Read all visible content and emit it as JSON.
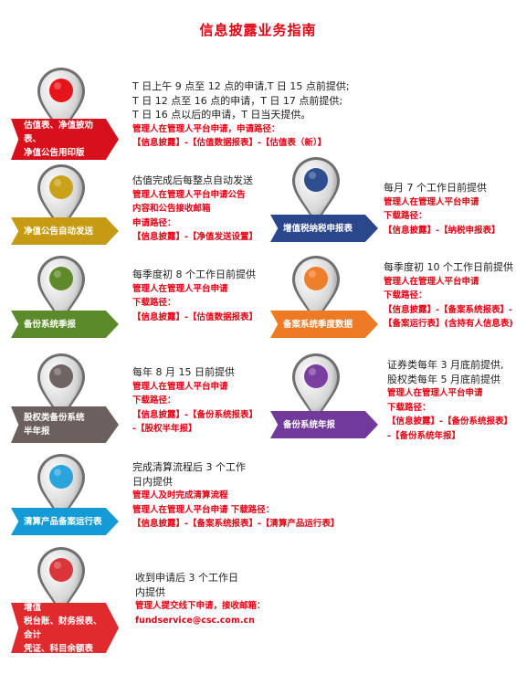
{
  "title": "信息披露业务指南",
  "left": [
    {
      "pin_color": "#e8141b",
      "tag_color": "#d7101b",
      "tag_lines": [
        "估值表、净值披劝表、",
        "净值公告用印版"
      ],
      "text_lines": [
        {
          "t": "T 日上午 9 点至 12 点的申请,T 日 15 点前提供;",
          "c": "k"
        },
        {
          "t": "T 日 12 点至 16 点的申请，T 日 17 点前提供;",
          "c": "k"
        },
        {
          "t": "T 日 16 点以后的申请，T 日当天提供。",
          "c": "k"
        },
        {
          "t": "管理人在管理人平台申请，申请路径：",
          "c": "r"
        },
        {
          "t": "【信息披露】-【估值数据报表】-【估值表（新）】",
          "c": "r"
        }
      ]
    },
    {
      "pin_color": "#c9a21a",
      "tag_color": "#c69a13",
      "tag_lines": [
        "净值公告自动发送"
      ],
      "text_lines": [
        {
          "t": "估值完成后每整点自动发送",
          "c": "k"
        },
        {
          "t": "管理人在管理人平台申请公告",
          "c": "r"
        },
        {
          "t": "内容和公告接收邮箱",
          "c": "r"
        },
        {
          "t": "申请路径：",
          "c": "r"
        },
        {
          "t": "【信息披露】-【净值发送设置】",
          "c": "r"
        }
      ]
    },
    {
      "pin_color": "#5f8a2c",
      "tag_color": "#5b8a2a",
      "tag_lines": [
        "备份系统季报"
      ],
      "text_lines": [
        {
          "t": "每季度初 8 个工作日前提供",
          "c": "k"
        },
        {
          "t": "管理人在管理人平台申请",
          "c": "r"
        },
        {
          "t": "下载路径：",
          "c": "r"
        },
        {
          "t": "【信息披露】-【估值数据报表】",
          "c": "r"
        }
      ]
    },
    {
      "pin_color": "#6f6462",
      "tag_color": "#6b605d",
      "tag_lines": [
        "股权类备份系统",
        "半年报"
      ],
      "text_lines": [
        {
          "t": "每年 8 月 15 日前提供",
          "c": "k"
        },
        {
          "t": "管理人在管理人平台申请",
          "c": "r"
        },
        {
          "t": "下载路径：",
          "c": "r"
        },
        {
          "t": "【信息披露】-【备份系统报表】",
          "c": "r"
        },
        {
          "t": "-【股权半年报】",
          "c": "r"
        }
      ]
    },
    {
      "pin_color": "#2ba4dc",
      "tag_color": "#139ad7",
      "tag_lines": [
        "清算产品备案运行表"
      ],
      "text_lines": [
        {
          "t": "完成清算流程后 3 个工作",
          "c": "k"
        },
        {
          "t": "日内提供",
          "c": "k"
        },
        {
          "t": "管理人及时完成清算流程",
          "c": "r"
        },
        {
          "t": "管理人在管理人平台申请  下载路径：",
          "c": "r"
        },
        {
          "t": "【信息披露】-【备案系统报表】-【清算产品运行表】",
          "c": "r"
        }
      ]
    },
    {
      "pin_color": "#d9353a",
      "tag_color": "#e02a2e",
      "tag_lines": [
        "其他估值材料（例如增值",
        "税台账、财务报表、会计",
        "凭证、科目余额表等）"
      ],
      "text_lines": [
        {
          "t": "收到申请后 3 个工作日",
          "c": "k"
        },
        {
          "t": "内提供",
          "c": "k"
        },
        {
          "t": "管理人提交线下申请，接收邮箱：",
          "c": "r"
        },
        {
          "t": "fundservice@csc.com.cn",
          "c": "r"
        }
      ]
    }
  ],
  "right": [
    {
      "pin_color": "#2e4e8f",
      "tag_color": "#2b478c",
      "tag_lines": [
        "增值税纳税申报表"
      ],
      "text_lines": [
        {
          "t": "每月 7 个工作日前提供",
          "c": "k"
        },
        {
          "t": "管理人在管理人平台申请",
          "c": "r"
        },
        {
          "t": "下载路径：",
          "c": "r"
        },
        {
          "t": "【信息披露】-【纳税申报表】",
          "c": "r"
        }
      ]
    },
    {
      "pin_color": "#ef7e2a",
      "tag_color": "#ee7a24",
      "tag_lines": [
        "备案系统季度数据"
      ],
      "text_lines": [
        {
          "t": "每季度初 10 个工作日前提供",
          "c": "k"
        },
        {
          "t": "管理人在管理人平台申请",
          "c": "r"
        },
        {
          "t": "下载路径：",
          "c": "r"
        },
        {
          "t": "【信息披露】-【备案系统报表】-",
          "c": "r"
        },
        {
          "t": "【备案运行表】(含持有人信息表)",
          "c": "r"
        }
      ]
    },
    {
      "pin_color": "#7a3ea0",
      "tag_color": "#71399c",
      "tag_lines": [
        "备份系统年报"
      ],
      "text_lines": [
        {
          "t": "证券类每年 3 月底前提供,",
          "c": "k"
        },
        {
          "t": "股权类每年 5 月底前提供",
          "c": "k"
        },
        {
          "t": "管理人在管理人平台申请",
          "c": "r"
        },
        {
          "t": "下载路径：",
          "c": "r"
        },
        {
          "t": "【信息披露】-【备份系统报表】",
          "c": "r"
        },
        {
          "t": "-【备份系统年报】",
          "c": "r"
        }
      ]
    }
  ]
}
